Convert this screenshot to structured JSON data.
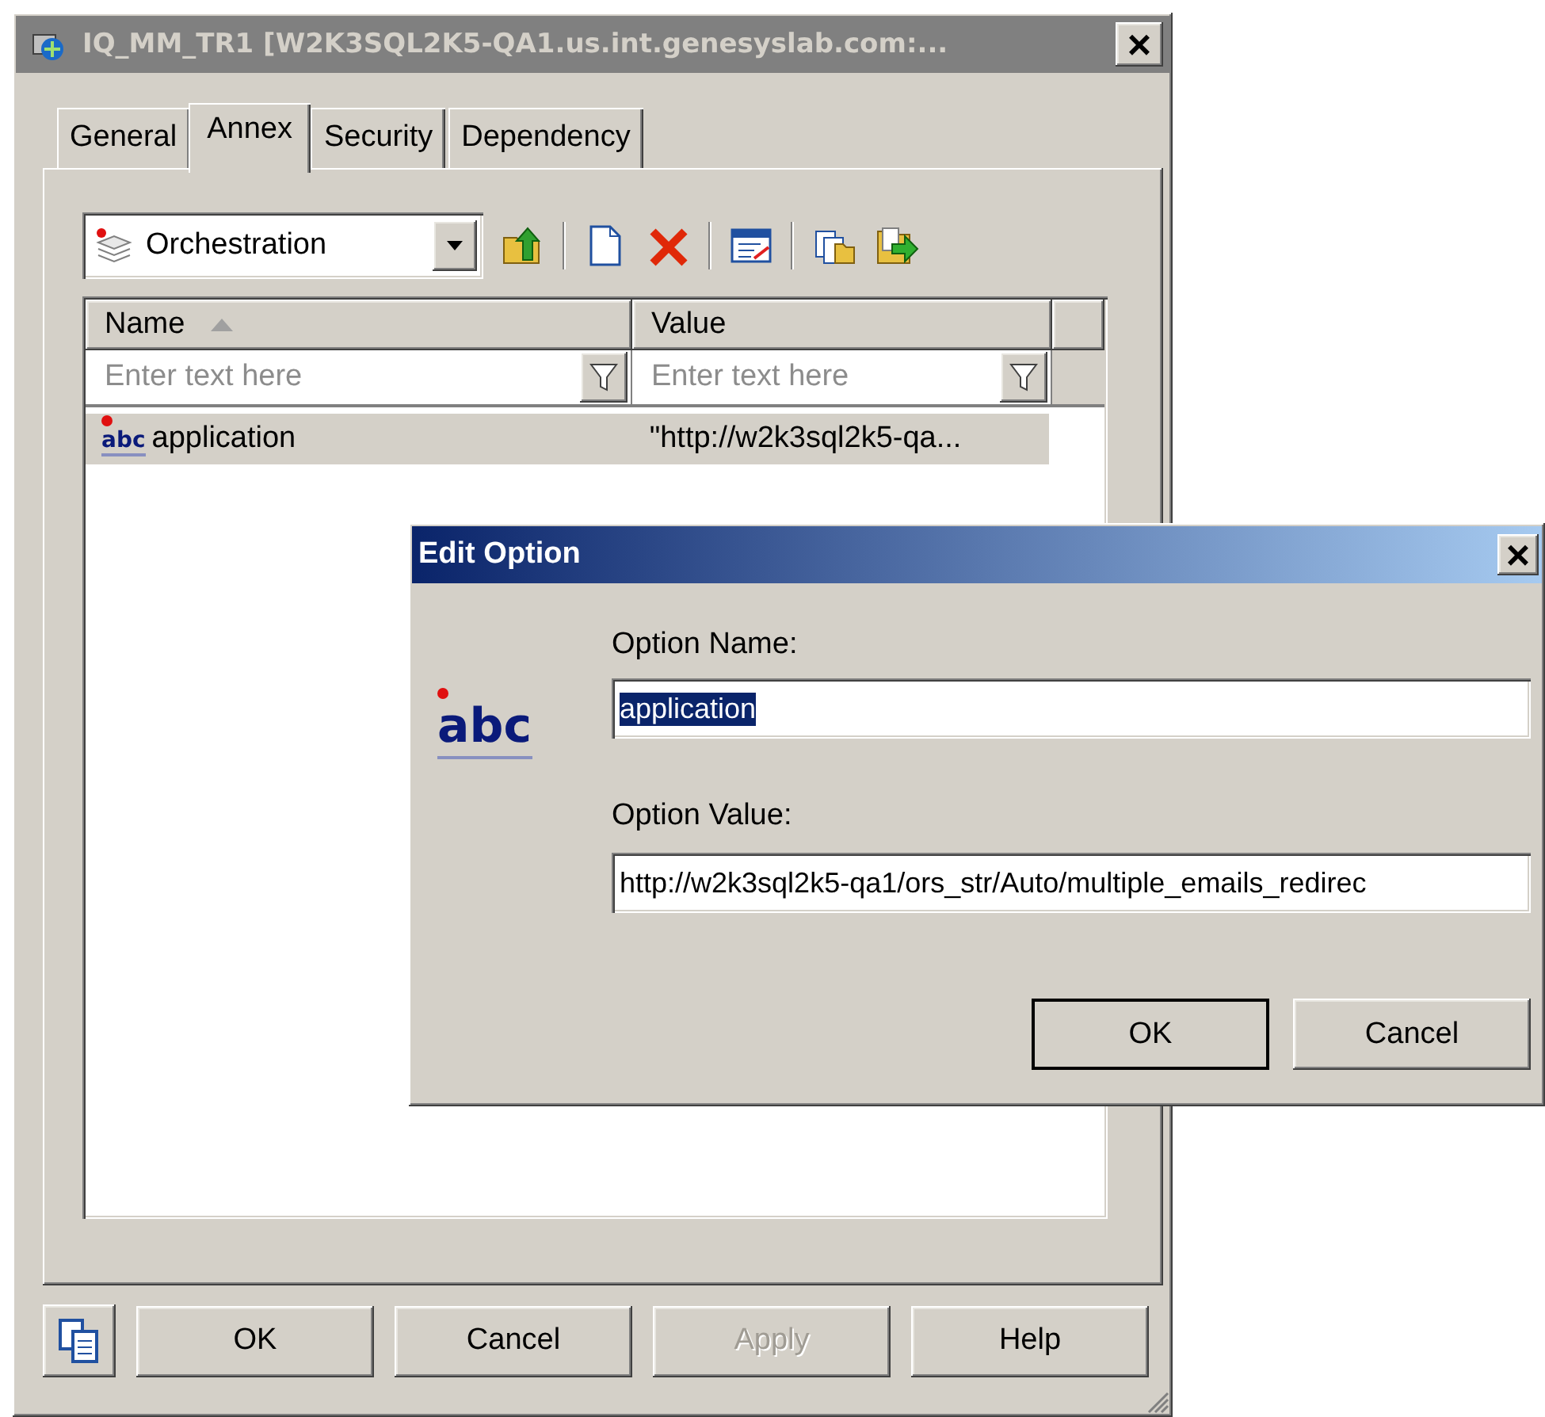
{
  "window": {
    "title": "IQ_MM_TR1 [W2K3SQL2K5-QA1.us.int.genesyslab.com:...",
    "active": false,
    "close": "×"
  },
  "tabs": [
    {
      "label": "General",
      "selected": false
    },
    {
      "label": "Annex",
      "selected": true
    },
    {
      "label": "Security",
      "selected": false
    },
    {
      "label": "Dependency",
      "selected": false
    }
  ],
  "section_dropdown": {
    "value": "Orchestration"
  },
  "table": {
    "columns": [
      {
        "label": "Name",
        "sorted": true,
        "filter_placeholder": "Enter text here"
      },
      {
        "label": "Value",
        "sorted": false,
        "filter_placeholder": "Enter text here"
      }
    ],
    "rows": [
      {
        "type_icon": "abc",
        "name": "application",
        "value": "\"http://w2k3sql2k5-qa...",
        "selected": true
      }
    ]
  },
  "buttons": [
    {
      "label": "OK",
      "disabled": false
    },
    {
      "label": "Cancel",
      "disabled": false
    },
    {
      "label": "Apply",
      "disabled": true
    },
    {
      "label": "Help",
      "disabled": false
    }
  ],
  "dialog": {
    "title": "Edit Option",
    "active": true,
    "close": "×",
    "type_icon": "abc",
    "name_label": "Option Name:",
    "name_value": "application",
    "name_value_selected": true,
    "value_label": "Option Value:",
    "value_value": "http://w2k3sql2k5-qa1/ors_str/Auto/multiple_emails_redirec",
    "buttons": [
      {
        "label": "OK",
        "default": true
      },
      {
        "label": "Cancel",
        "default": false
      }
    ]
  }
}
